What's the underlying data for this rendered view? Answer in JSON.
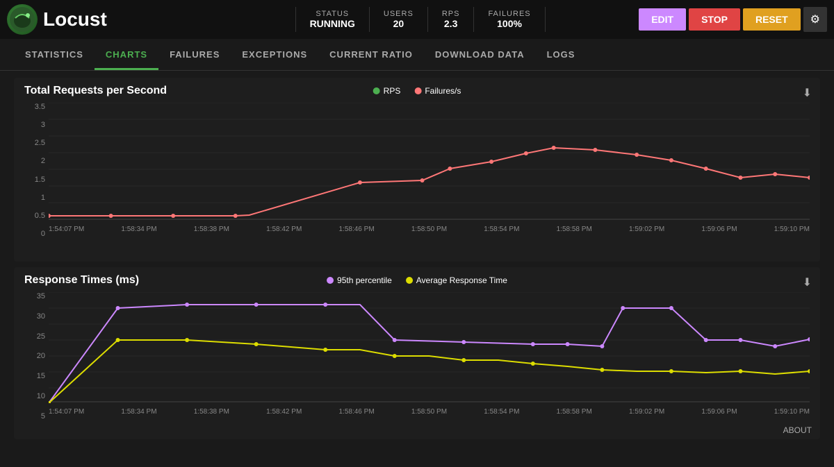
{
  "header": {
    "logo_text": "Locust",
    "stats": [
      {
        "label": "STATUS",
        "value": "RUNNING"
      },
      {
        "label": "USERS",
        "value": "20"
      },
      {
        "label": "RPS",
        "value": "2.3"
      },
      {
        "label": "FAILURES",
        "value": "100%"
      }
    ],
    "buttons": {
      "edit": "EDIT",
      "stop": "STOP",
      "reset": "RESET"
    }
  },
  "nav": {
    "items": [
      {
        "label": "STATISTICS",
        "active": false
      },
      {
        "label": "CHARTS",
        "active": true
      },
      {
        "label": "FAILURES",
        "active": false
      },
      {
        "label": "EXCEPTIONS",
        "active": false
      },
      {
        "label": "CURRENT RATIO",
        "active": false
      },
      {
        "label": "DOWNLOAD DATA",
        "active": false
      },
      {
        "label": "LOGS",
        "active": false
      }
    ]
  },
  "chart1": {
    "title": "Total Requests per Second",
    "legend": [
      {
        "label": "RPS",
        "color": "#4CAF50"
      },
      {
        "label": "Failures/s",
        "color": "#ff7777"
      }
    ],
    "y_labels": [
      "3.5",
      "3",
      "2.5",
      "2",
      "1.5",
      "1",
      "0.5",
      "0"
    ],
    "x_labels": [
      "1:54:07 PM",
      "1:58:34 PM",
      "1:58:38 PM",
      "1:58:42 PM",
      "1:58:46 PM",
      "1:58:50 PM",
      "1:58:54 PM",
      "1:58:58 PM",
      "1:59:02 PM",
      "1:59:06 PM",
      "1:59:10 PM"
    ],
    "download_icon": "⬇"
  },
  "chart2": {
    "title": "Response Times (ms)",
    "legend": [
      {
        "label": "95th percentile",
        "color": "#cc88ff"
      },
      {
        "label": "Average Response Time",
        "color": "#dddd00"
      }
    ],
    "y_labels": [
      "35",
      "30",
      "25",
      "20",
      "15",
      "10",
      "5"
    ],
    "x_labels": [
      "1:54:07 PM",
      "1:58:34 PM",
      "1:58:38 PM",
      "1:58:42 PM",
      "1:58:46 PM",
      "1:58:50 PM",
      "1:58:54 PM",
      "1:58:58 PM",
      "1:59:02 PM",
      "1:59:06 PM",
      "1:59:10 PM"
    ],
    "download_icon": "⬇"
  },
  "footer": {
    "about": "ABOUT"
  }
}
